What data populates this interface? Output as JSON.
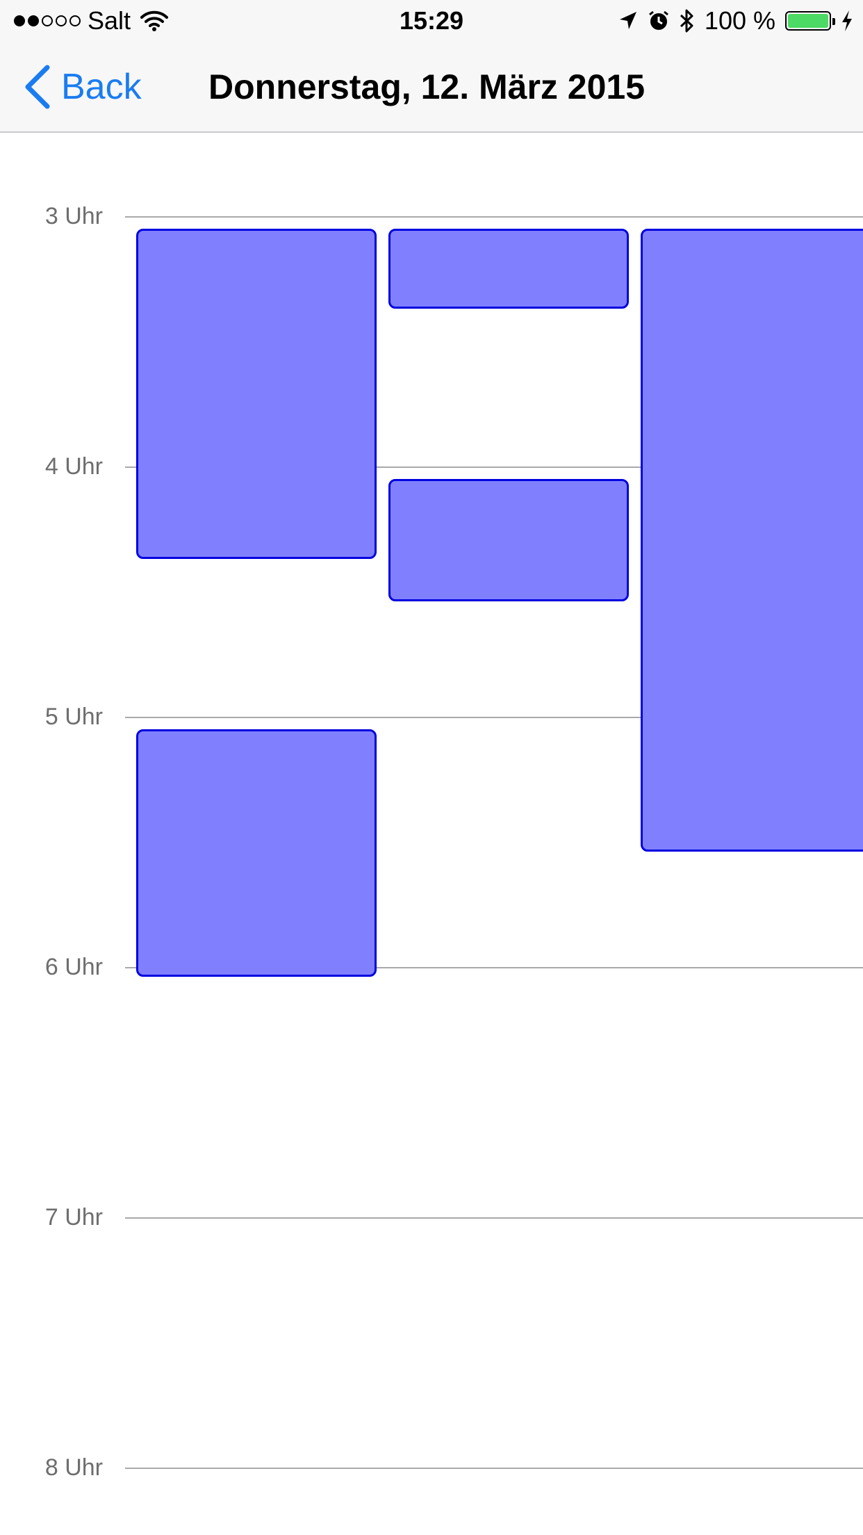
{
  "status_bar": {
    "signal_dots": [
      true,
      true,
      false,
      false,
      false
    ],
    "carrier": "Salt",
    "time": "15:29",
    "battery_text": "100 %",
    "battery_level": 1.0,
    "battery_color": "#4cd964",
    "icons": [
      "wifi-icon",
      "location-arrow-icon",
      "alarm-icon",
      "bluetooth-icon",
      "battery-icon",
      "charging-bolt-icon"
    ]
  },
  "nav": {
    "back_label": "Back",
    "title": "Donnerstag, 12. März 2015",
    "accent": "#1a7cf0"
  },
  "day_view": {
    "hours": [
      "3 Uhr",
      "4 Uhr",
      "5 Uhr",
      "6 Uhr",
      "7 Uhr",
      "8 Uhr"
    ],
    "event_fill": "#8080ff",
    "event_border": "#0000e0",
    "events": [
      {
        "column": 0,
        "start_hour": 3.05,
        "end_hour": 4.37
      },
      {
        "column": 1,
        "start_hour": 3.05,
        "end_hour": 3.37
      },
      {
        "column": 2,
        "start_hour": 3.05,
        "end_hour": 5.54
      },
      {
        "column": 1,
        "start_hour": 4.05,
        "end_hour": 4.54
      },
      {
        "column": 0,
        "start_hour": 5.05,
        "end_hour": 6.04
      }
    ]
  }
}
